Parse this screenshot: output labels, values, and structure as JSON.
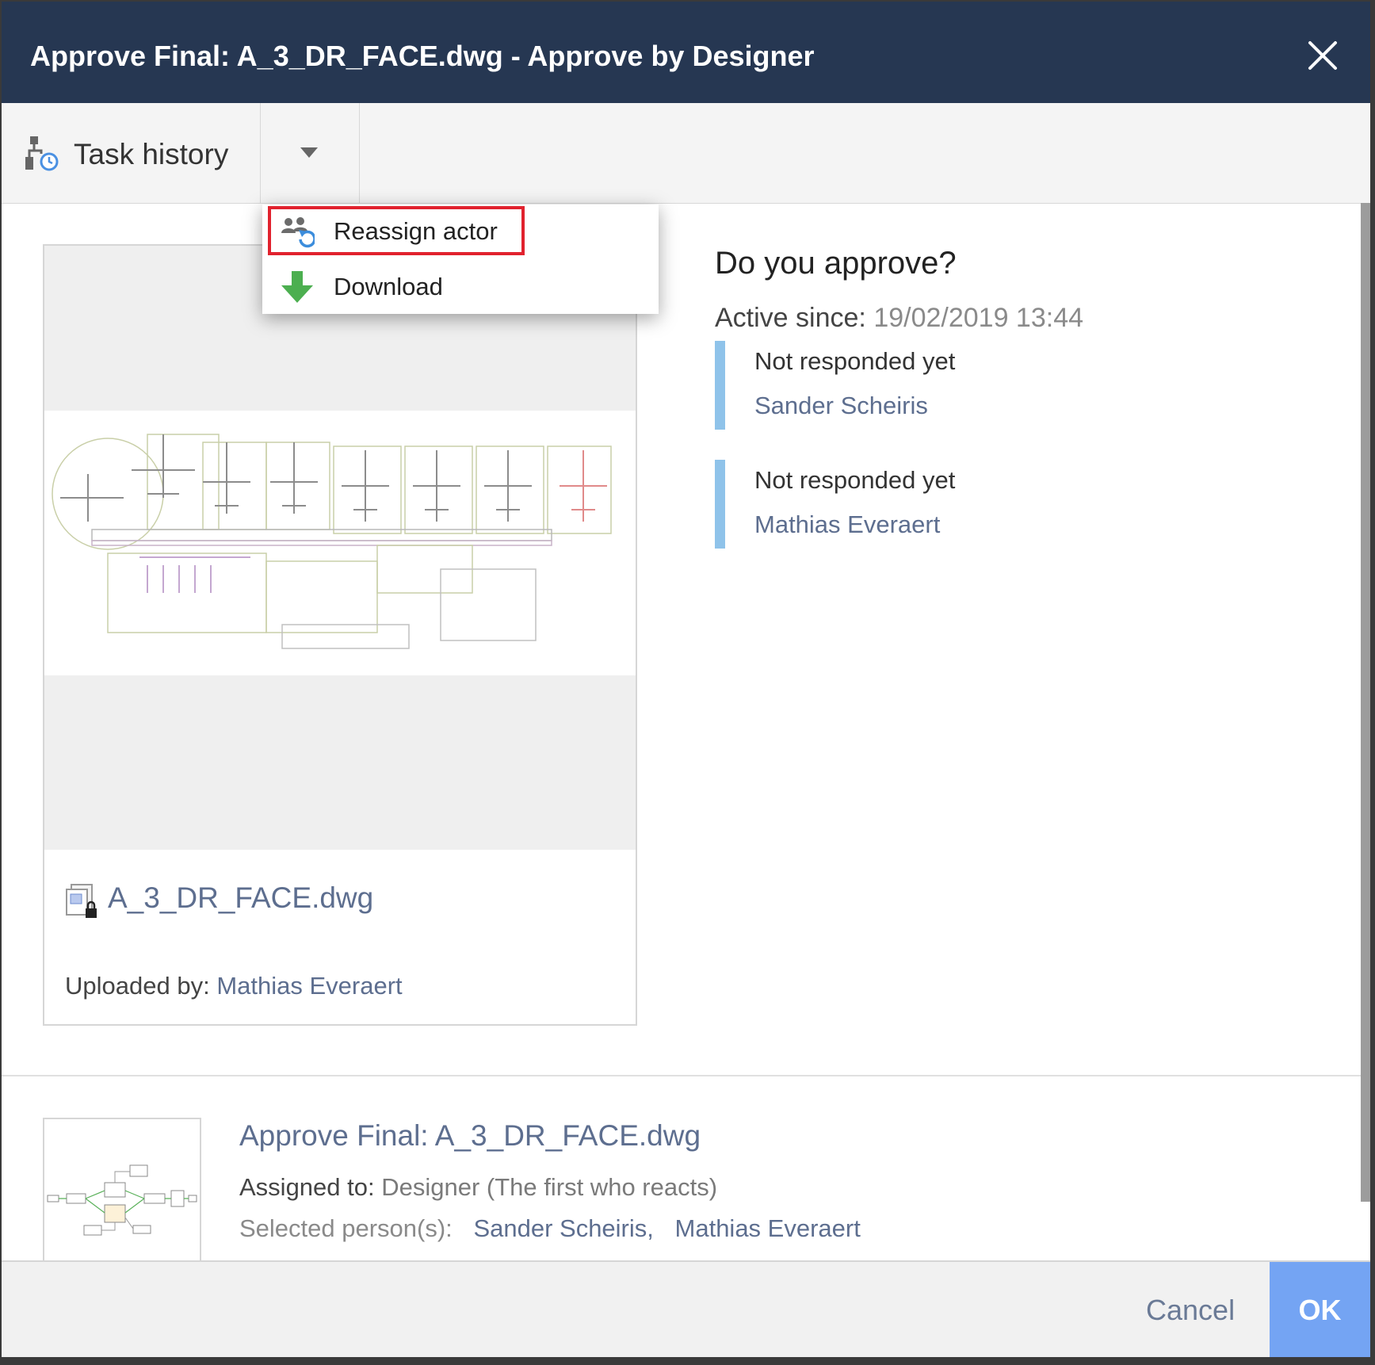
{
  "dialog": {
    "title": "Approve Final: A_3_DR_FACE.dwg - Approve by Designer"
  },
  "toolbar": {
    "task_history_label": "Task history"
  },
  "menu": {
    "items": [
      {
        "label": "Reassign actor",
        "icon": "reassign-actor-icon"
      },
      {
        "label": "Download",
        "icon": "download-arrow-icon"
      }
    ]
  },
  "document": {
    "file_name": "A_3_DR_FACE.dwg",
    "uploaded_by_label": "Uploaded by:",
    "uploaded_by": "Mathias Everaert"
  },
  "approval": {
    "question": "Do you approve?",
    "active_since_label": "Active since:",
    "active_since": "19/02/2019 13:44",
    "responses": [
      {
        "status": "Not responded yet",
        "person": "Sander Scheiris"
      },
      {
        "status": "Not responded yet",
        "person": "Mathias Everaert"
      }
    ]
  },
  "workflow": {
    "title": "Approve Final: A_3_DR_FACE.dwg",
    "assigned_label": "Assigned to:",
    "assigned_value": "Designer (The first who reacts)",
    "selected_label": "Selected person(s):",
    "selected_people": [
      "Sander Scheiris,",
      "Mathias Everaert"
    ]
  },
  "footer": {
    "cancel_label": "Cancel",
    "ok_label": "OK"
  },
  "colors": {
    "titlebar": "#263752",
    "link": "#5d6e8f",
    "accent_bar": "#8fc3ea",
    "ok_button": "#74a4f3",
    "highlight": "#e1222e"
  }
}
